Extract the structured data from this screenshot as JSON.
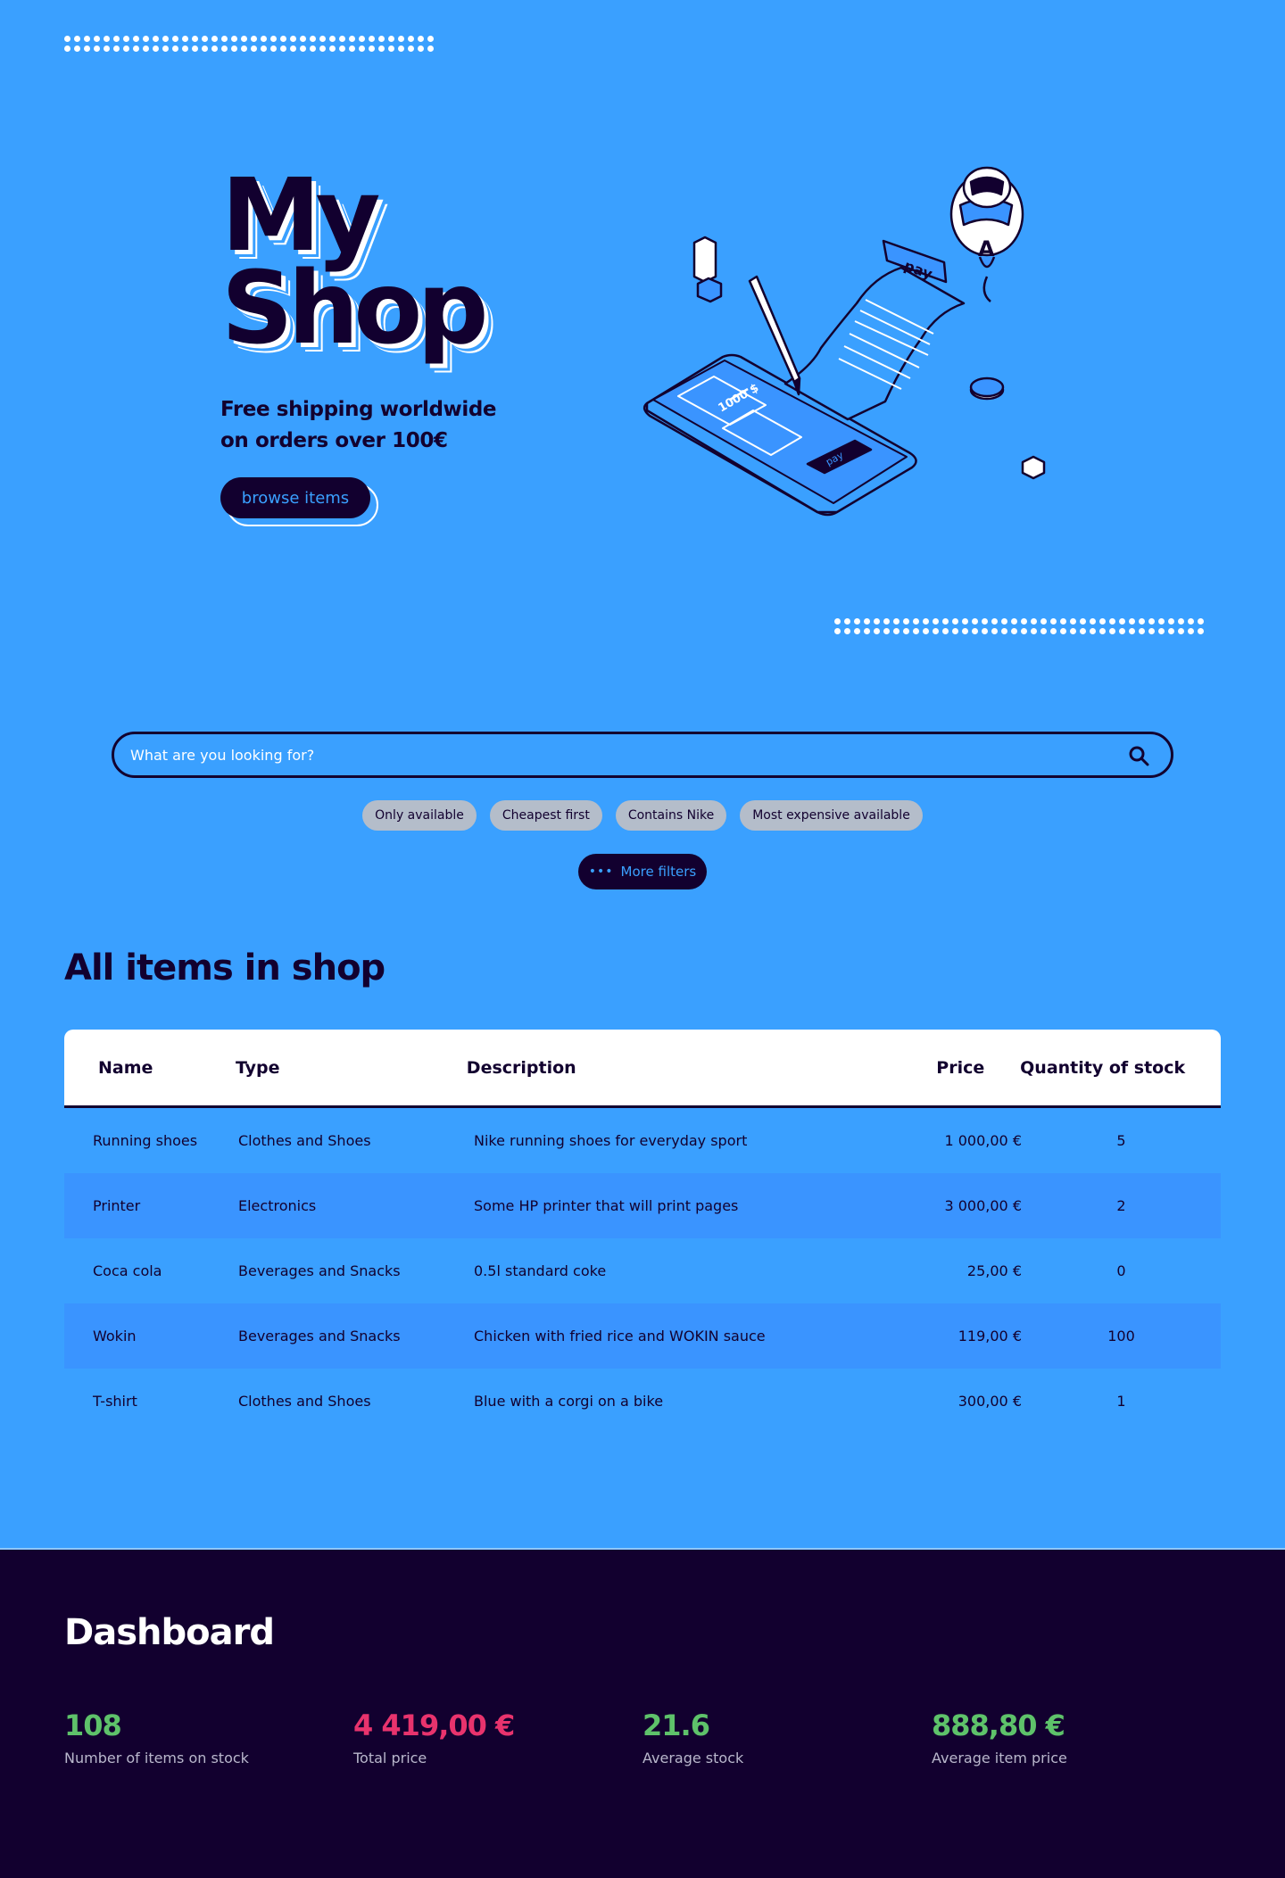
{
  "hero": {
    "title_line1": "My",
    "title_line2": "Shop",
    "tagline_line1": "Free shipping worldwide",
    "tagline_line2": "on orders over 100€",
    "browse_label": "browse items",
    "illustration_texts": {
      "amount": "1000 $",
      "pay_tag": "pay",
      "pay_button": "pay",
      "robot_letter": "A"
    }
  },
  "search": {
    "placeholder": "What are you looking for?",
    "icon": "search-icon"
  },
  "filters": {
    "chips": [
      "Only available",
      "Cheapest first",
      "Contains Nike",
      "Most expensive available"
    ],
    "more_label": "More filters",
    "more_icon": "ellipsis-icon"
  },
  "items_section": {
    "title": "All items in shop",
    "columns": [
      "Name",
      "Type",
      "Description",
      "Price",
      "Quantity of stock"
    ],
    "rows": [
      [
        "Running shoes",
        "Clothes and Shoes",
        "Nike running shoes for everyday sport",
        "1 000,00 €",
        "5"
      ],
      [
        "Printer",
        "Electronics",
        "Some HP printer that will print pages",
        "3 000,00 €",
        "2"
      ],
      [
        "Coca cola",
        "Beverages and Snacks",
        "0.5l standard coke",
        "25,00 €",
        "0"
      ],
      [
        "Wokin",
        "Beverages and Snacks",
        "Chicken with fried rice and WOKIN sauce",
        "119,00 €",
        "100"
      ],
      [
        "T-shirt",
        "Clothes and Shoes",
        "Blue with a corgi on a bike",
        "300,00 €",
        "1"
      ]
    ]
  },
  "dashboard": {
    "title": "Dashboard",
    "stats": [
      {
        "value": "108",
        "label": "Number of items on stock",
        "color": "#5ec26a"
      },
      {
        "value": "4 419,00 €",
        "label": "Total price",
        "color": "#e8336d"
      },
      {
        "value": "21.6",
        "label": "Average stock",
        "color": "#5ec26a"
      },
      {
        "value": "888,80 €",
        "label": "Average item price",
        "color": "#5ec26a"
      }
    ]
  },
  "colors": {
    "background": "#3aa0ff",
    "navy": "#12002f",
    "row_alt": "#3a94ff",
    "chip": "#b4bdca"
  }
}
